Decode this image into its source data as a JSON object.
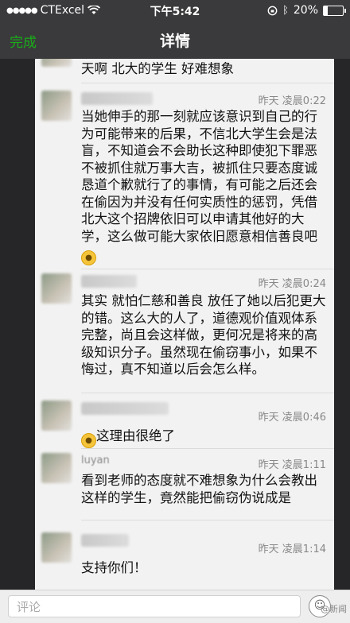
{
  "status_bar": {
    "carrier": "CTExcel",
    "time": "下午5:42",
    "battery": "20%",
    "battery_level": 0.2
  },
  "nav": {
    "back": "完成",
    "title": "详情"
  },
  "comments": [
    {
      "text": "天啊 北大的学生 好难想象",
      "meta": "",
      "nickname": ""
    },
    {
      "text": "当她伸手的那一刻就应该意识到自己的行为可能带来的后果，不信北大学生会是法盲，不知道会不会助长这种即使犯下罪恶不被抓住就万事大吉，被抓住只要态度诚恳道个歉就行了的事情，有可能之后还会在偷因为并没有任何实质性的惩罚，凭借北大这个招牌依旧可以申请其他好的大学，这么做可能大家依旧愿意相信善良吧",
      "meta": "昨天 凌晨0:22",
      "nickname": ""
    },
    {
      "text": "其实 就怕仁慈和善良 放任了她以后犯更大的错。这么大的人了，道德观价值观体系完整，尚且会这样做，更何况是将来的高级知识分子。虽然现在偷窃事小，如果不悔过，真不知道以后会怎么样。",
      "meta": "昨天 凌晨0:24",
      "nickname": ""
    },
    {
      "text": "这理由很绝了",
      "meta": "昨天 凌晨0:46",
      "nickname": ""
    },
    {
      "text": "看到老师的态度就不难想象为什么会教出这样的学生，竟然能把偷窃伪说成是",
      "meta": "昨天 凌晨1:11",
      "nickname": "luyan"
    },
    {
      "text": "支持你们！",
      "meta": "昨天 凌晨1:14",
      "nickname": ""
    }
  ],
  "comment_bar": {
    "placeholder": "评论"
  },
  "watermark": "@新闻"
}
